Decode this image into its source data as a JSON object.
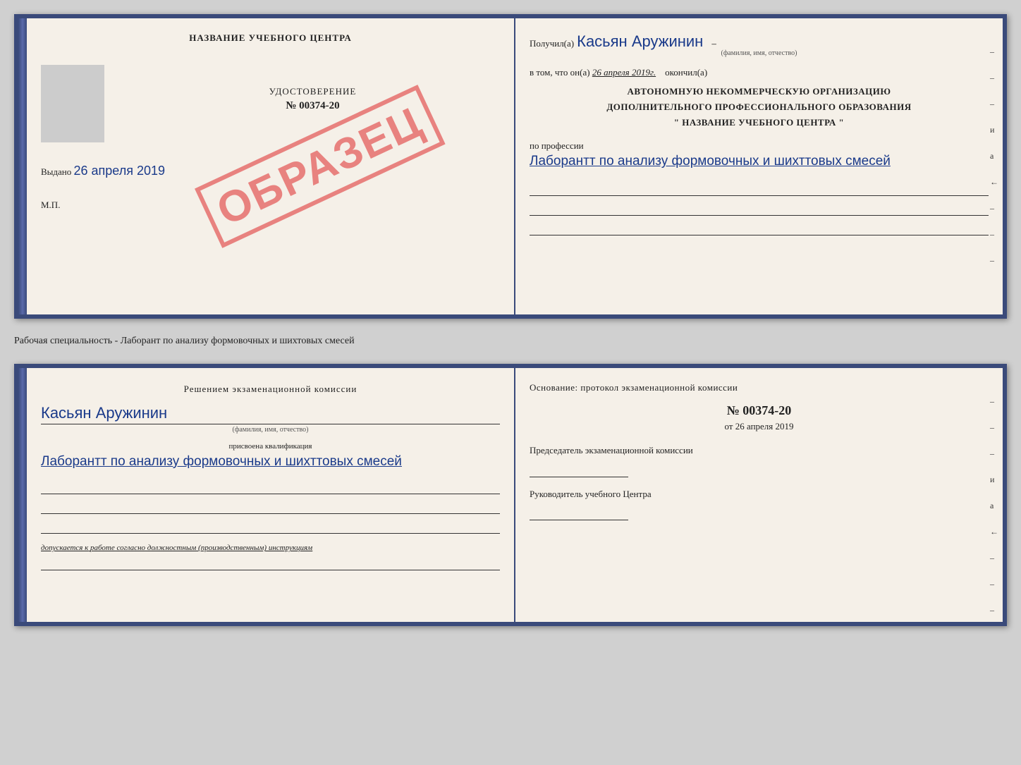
{
  "page": {
    "background": "#d0d0d0"
  },
  "top_book": {
    "left": {
      "title": "НАЗВАНИЕ УЧЕБНОГО ЦЕНТРА",
      "udost_label": "УДОСТОВЕРЕНИЕ",
      "number": "№ 00374-20",
      "issued_label": "Выдано",
      "issued_date": "26 апреля 2019",
      "mp_label": "М.П.",
      "stamp_text": "ОБРАЗЕЦ"
    },
    "right": {
      "received_label": "Получил(а)",
      "received_name": "Касьян Аружинин",
      "received_sub": "(фамилия, имя, отчество)",
      "date_label": "в том, что он(а)",
      "date_value": "26 апреля 2019г.",
      "finished_label": "окончил(а)",
      "org_line1": "АВТОНОМНУЮ НЕКОММЕРЧЕСКУЮ ОРГАНИЗАЦИЮ",
      "org_line2": "ДОПОЛНИТЕЛЬНОГО ПРОФЕССИОНАЛЬНОГО ОБРАЗОВАНИЯ",
      "org_line3": "\" НАЗВАНИЕ УЧЕБНОГО ЦЕНТРА \"",
      "prof_label": "по профессии",
      "prof_value": "Лаборантт по анализу формовочных и шихттовых смесей",
      "side_marks": [
        "-",
        "-",
        "-",
        "и",
        "а",
        "←",
        "-",
        "-",
        "-"
      ]
    }
  },
  "middle_text": "Рабочая специальность - Лаборант по анализу формовочных и шихтовых смесей",
  "bottom_book": {
    "left": {
      "heading": "Решением экзаменационной комиссии",
      "name": "Касьян Аружинин",
      "name_sub": "(фамилия, имя, отчество)",
      "qual_label": "присвоена квалификация",
      "qual_value": "Лаборантт по анализу формовочных и шихттовых смесей",
      "dopusk_label": "допускается к",
      "dopusk_value": "работе согласно должностным (производственным) инструкциям"
    },
    "right": {
      "heading": "Основание: протокол экзаменационной комиссии",
      "number": "№ 00374-20",
      "date_prefix": "от",
      "date_value": "26 апреля 2019",
      "chairman_label": "Председатель экзаменационной комиссии",
      "director_label": "Руководитель учебного Центра",
      "side_marks": [
        "-",
        "-",
        "-",
        "и",
        "а",
        "←",
        "-",
        "-",
        "-"
      ]
    }
  }
}
